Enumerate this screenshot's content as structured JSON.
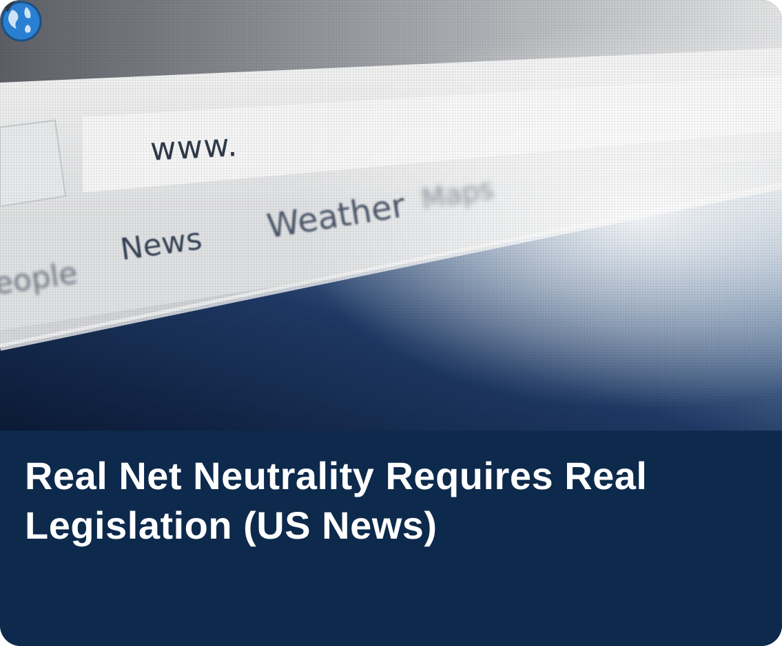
{
  "photo": {
    "address_bar_text": "www.",
    "menu_items": [
      "eople",
      "News",
      "Weather"
    ],
    "blurred_word": "Maps",
    "icons": [
      "plus-icon",
      "globe-icon",
      "dropdown-arrow-icon"
    ]
  },
  "caption": {
    "headline": "Real Net Neutrality Requires Real Legislation (US News)"
  },
  "colors": {
    "caption_background": "#0d2a4c",
    "headline_text": "#ffffff",
    "globe_blue": "#2a7fd0"
  }
}
